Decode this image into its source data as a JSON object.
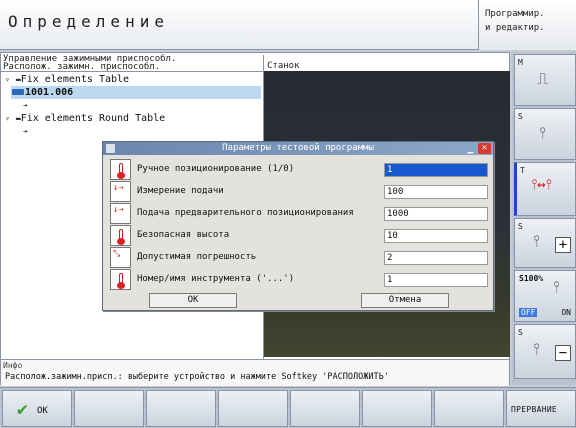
{
  "header": {
    "title": "Определение",
    "mode_line1": "Программир.",
    "mode_line2": "и редактир."
  },
  "left_panel": {
    "heading_line1": "Управление зажимными приспособл.",
    "heading_line2": "Располож. зажимн. приспособл."
  },
  "tree": [
    {
      "label": "Fix elements Table",
      "kind": "group"
    },
    {
      "label": "1001.006",
      "kind": "item",
      "selected": true
    },
    {
      "label": "",
      "kind": "leaf"
    },
    {
      "label": "Fix elements Round Table",
      "kind": "group"
    },
    {
      "label": "",
      "kind": "leaf"
    }
  ],
  "machine_label": "Станок",
  "info": {
    "label": "Инфо",
    "message": "Располож.зажимн.присп.: выберите устройство и нажмите Softkey 'РАСПОЛОЖИТЬ'"
  },
  "dialog": {
    "title": "Параметры тестовой программы",
    "fields": [
      {
        "label": "Ручное позиционирование (1/0)",
        "value": "1",
        "active": true
      },
      {
        "label": "Измерение подачи",
        "value": "100"
      },
      {
        "label": "Подача предварительного позиционирования",
        "value": "1000"
      },
      {
        "label": "Безопасная высота",
        "value": "10"
      },
      {
        "label": "Допустимая погрешность",
        "value": "2"
      },
      {
        "label": "Номер/имя инструмента ('...')",
        "value": "1"
      }
    ],
    "ok_label": "OK",
    "cancel_label": "Отмена"
  },
  "right_softkeys": {
    "k1": "M",
    "k2": "S",
    "k3": "T",
    "k4": "S",
    "k5_pct": "S100%",
    "k5_off": "OFF",
    "k5_on": "ON",
    "k6": "S"
  },
  "bottom_softkeys": {
    "ok_label": "OK",
    "cancel_label": "ПРЕРВАНИЕ"
  },
  "colors": {
    "active_field": "#1558d0",
    "dialog_title": "#6b86ac",
    "close_red": "#d43c2c",
    "ok_green": "#3aa02a"
  }
}
